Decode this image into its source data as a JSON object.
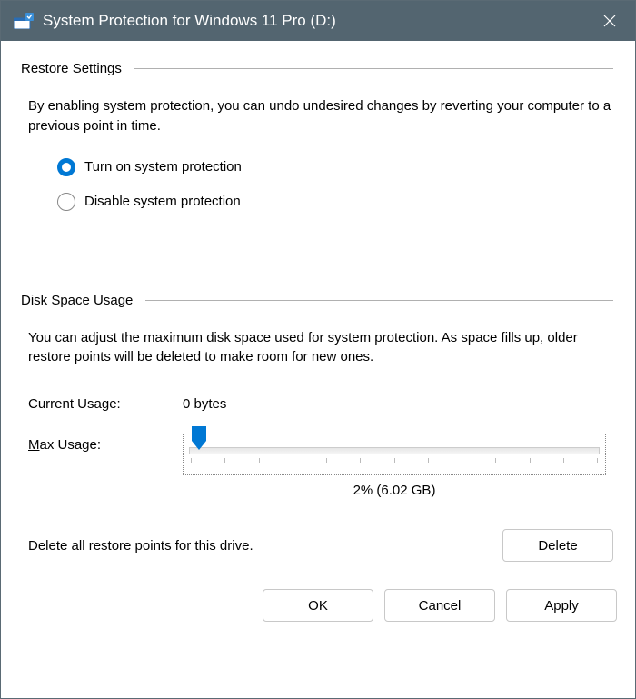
{
  "window": {
    "title": "System Protection for Windows 11 Pro (D:)"
  },
  "restore": {
    "section_title": "Restore Settings",
    "description": "By enabling system protection, you can undo undesired changes by reverting your computer to a previous point in time.",
    "options": {
      "turn_on": "Turn on system protection",
      "disable": "Disable system protection"
    }
  },
  "disk": {
    "section_title": "Disk Space Usage",
    "description": "You can adjust the maximum disk space used for system protection. As space fills up, older restore points will be deleted to make room for new ones.",
    "current_usage_label": "Current Usage:",
    "current_usage_value": "0 bytes",
    "max_usage_label_prefix": "M",
    "max_usage_label_rest": "ax Usage:",
    "slider_value": "2% (6.02 GB)",
    "delete_text": "Delete all restore points for this drive.",
    "delete_button": "Delete"
  },
  "footer": {
    "ok": "OK",
    "cancel": "Cancel",
    "apply": "Apply"
  }
}
